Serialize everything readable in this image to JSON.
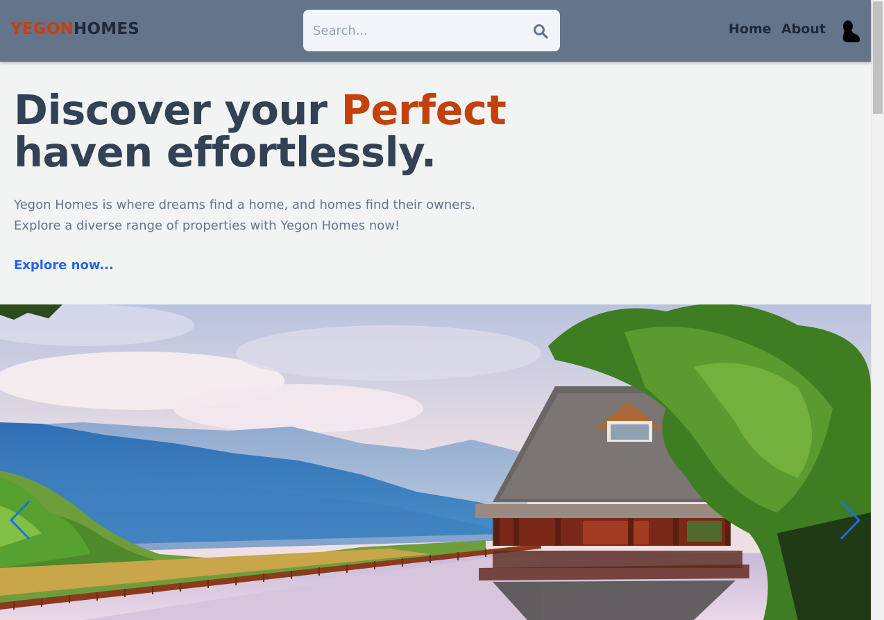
{
  "header": {
    "logo_part1": "YEGON",
    "logo_part2": "HOMES",
    "search_placeholder": "Search...",
    "nav": [
      {
        "label": "Home"
      },
      {
        "label": "About"
      }
    ]
  },
  "hero": {
    "title_part1": "Discover your ",
    "title_accent": "Perfect",
    "title_part2": "haven effortlessly.",
    "subtitle_line1": "Yegon Homes is where dreams find a home, and homes find their owners.",
    "subtitle_line2": "Explore a diverse range of properties with Yegon Homes now!",
    "cta_label": "Explore now..."
  },
  "icons": {
    "search": "search-icon",
    "avatar": "user-silhouette-icon",
    "prev": "chevron-left-icon",
    "next": "chevron-right-icon"
  },
  "colors": {
    "header_bg": "#64748b",
    "accent": "#c2410c",
    "dark_text": "#1e293b",
    "link": "#2563eb",
    "page_bg": "#f1f4f3"
  }
}
